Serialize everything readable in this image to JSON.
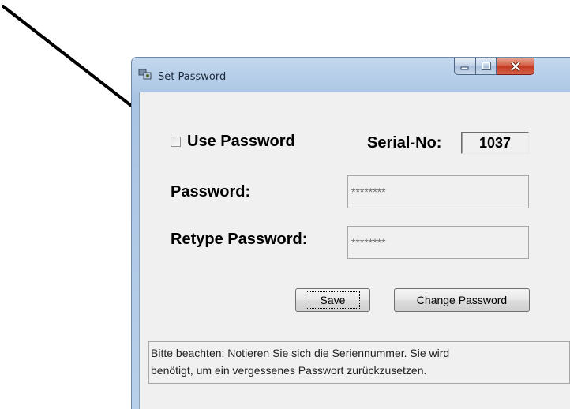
{
  "window": {
    "title": "Set Password",
    "icon": "app-icon",
    "caption_buttons": [
      "minimize-icon",
      "maximize-icon",
      "close-icon"
    ]
  },
  "form": {
    "use_password_label": "Use Password",
    "use_password_checked": false,
    "serial_label": "Serial-No:",
    "serial_value": "1037",
    "password_label": "Password:",
    "password_value": "********",
    "retype_label": "Retype Password:",
    "retype_value": "********"
  },
  "buttons": {
    "save": "Save",
    "change_password": "Change Password"
  },
  "note": {
    "line1": "Bitte beachten: Notieren Sie sich die Seriennummer. Sie wird",
    "line2": "benötigt, um ein vergessenes Passwort zurückzusetzen."
  },
  "colors": {
    "annotation_arrow": "#000000",
    "close_button": "#c23a20"
  }
}
